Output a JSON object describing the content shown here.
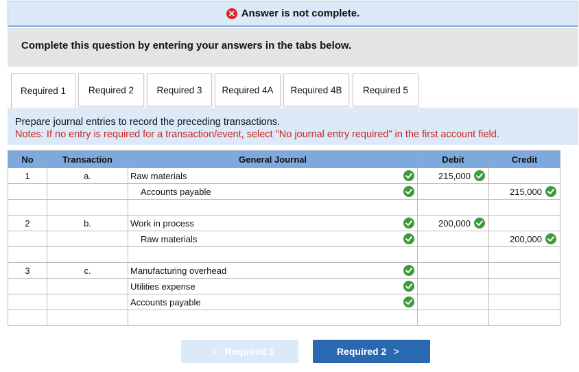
{
  "banner": {
    "text": "Answer is not complete."
  },
  "instruction": "Complete this question by entering your answers in the tabs below.",
  "tabs": [
    {
      "label": "Required 1",
      "active": true
    },
    {
      "label": "Required 2"
    },
    {
      "label": "Required 3"
    },
    {
      "label": "Required 4A"
    },
    {
      "label": "Required 4B"
    },
    {
      "label": "Required 5"
    }
  ],
  "prompt": {
    "line1": "Prepare journal entries to record the preceding transactions.",
    "note": "Notes: If no entry is required for a transaction/event, select \"No journal entry required\" in the first account field."
  },
  "table": {
    "headers": {
      "no": "No",
      "transaction": "Transaction",
      "journal": "General Journal",
      "debit": "Debit",
      "credit": "Credit"
    },
    "rows": [
      {
        "no": "1",
        "transaction": "a.",
        "account": "Raw materials",
        "debit": "215,000",
        "credit": ""
      },
      {
        "no": "",
        "transaction": "",
        "account": "Accounts payable",
        "debit": "",
        "credit": "215,000"
      },
      {
        "no": "",
        "transaction": "",
        "account": "",
        "debit": "",
        "credit": ""
      },
      {
        "no": "2",
        "transaction": "b.",
        "account": "Work in process",
        "debit": "200,000",
        "credit": ""
      },
      {
        "no": "",
        "transaction": "",
        "account": "Raw materials",
        "debit": "",
        "credit": "200,000"
      },
      {
        "no": "",
        "transaction": "",
        "account": "",
        "debit": "",
        "credit": ""
      },
      {
        "no": "3",
        "transaction": "c.",
        "account": "Manufacturing overhead",
        "debit": "",
        "credit": ""
      },
      {
        "no": "",
        "transaction": "",
        "account": "Utilities expense",
        "debit": "",
        "credit": ""
      },
      {
        "no": "",
        "transaction": "",
        "account": "Accounts payable",
        "debit": "",
        "credit": ""
      },
      {
        "no": "",
        "transaction": "",
        "account": "",
        "debit": "",
        "credit": ""
      }
    ]
  },
  "nav": {
    "prev_label": "Required 1",
    "next_label": "Required 2",
    "prev_chevron": "<",
    "next_chevron": ">"
  },
  "colors": {
    "header": "#7ea9dd",
    "check": "#3f9a3c",
    "error": "#d9262b",
    "note": "#c8261e",
    "next_button": "#2a68b1"
  }
}
